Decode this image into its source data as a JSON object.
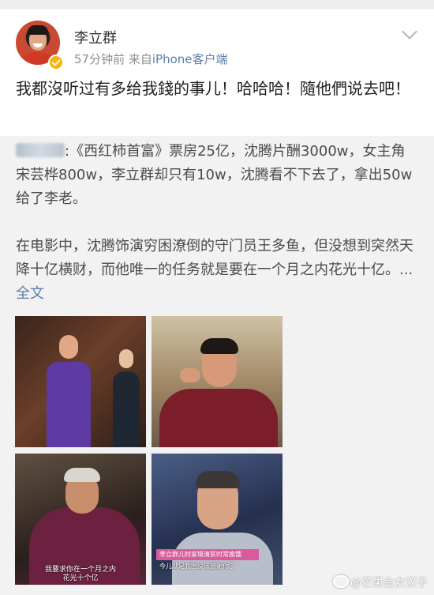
{
  "post": {
    "username": "李立群",
    "time": "57分钟前",
    "source_prefix": "来自",
    "source": "iPhone客户端",
    "text": "我都沒听过有多给我錢的事儿！哈哈哈！隨他們说去吧！"
  },
  "repost": {
    "paragraph1": ":《西红柿首富》票房25亿，沈腾片酬3000w，女主角宋芸桦800w，李立群却只有10w，沈腾看不下去了，拿出50w给了李老。",
    "paragraph2": "在电影中，沈腾饰演穷困潦倒的守门员王多鱼，但没想到突然天降十亿横财，而他唯一的任务就是要在一个月之内花光十亿。... ",
    "read_more": "全文"
  },
  "photos": [
    {
      "name": "photo-1"
    },
    {
      "name": "photo-2"
    },
    {
      "name": "photo-3",
      "subtitle_line1": "我要求你在一个月之内",
      "subtitle_line2": "花光十个亿"
    },
    {
      "name": "photo-4",
      "caption_bar": "李立群儿时家境清贫时常挨饿",
      "caption": "今儿就是我国没法感谢你了"
    }
  ],
  "watermark": "@芒果台女汉子",
  "icons": {
    "more": "chevron-down-icon",
    "verified": "verified-badge-icon",
    "watermark": "weibo-icon"
  },
  "colors": {
    "link": "#5b7ea8",
    "verified": "#f7b500",
    "repost_background": "#f2f2f2"
  }
}
